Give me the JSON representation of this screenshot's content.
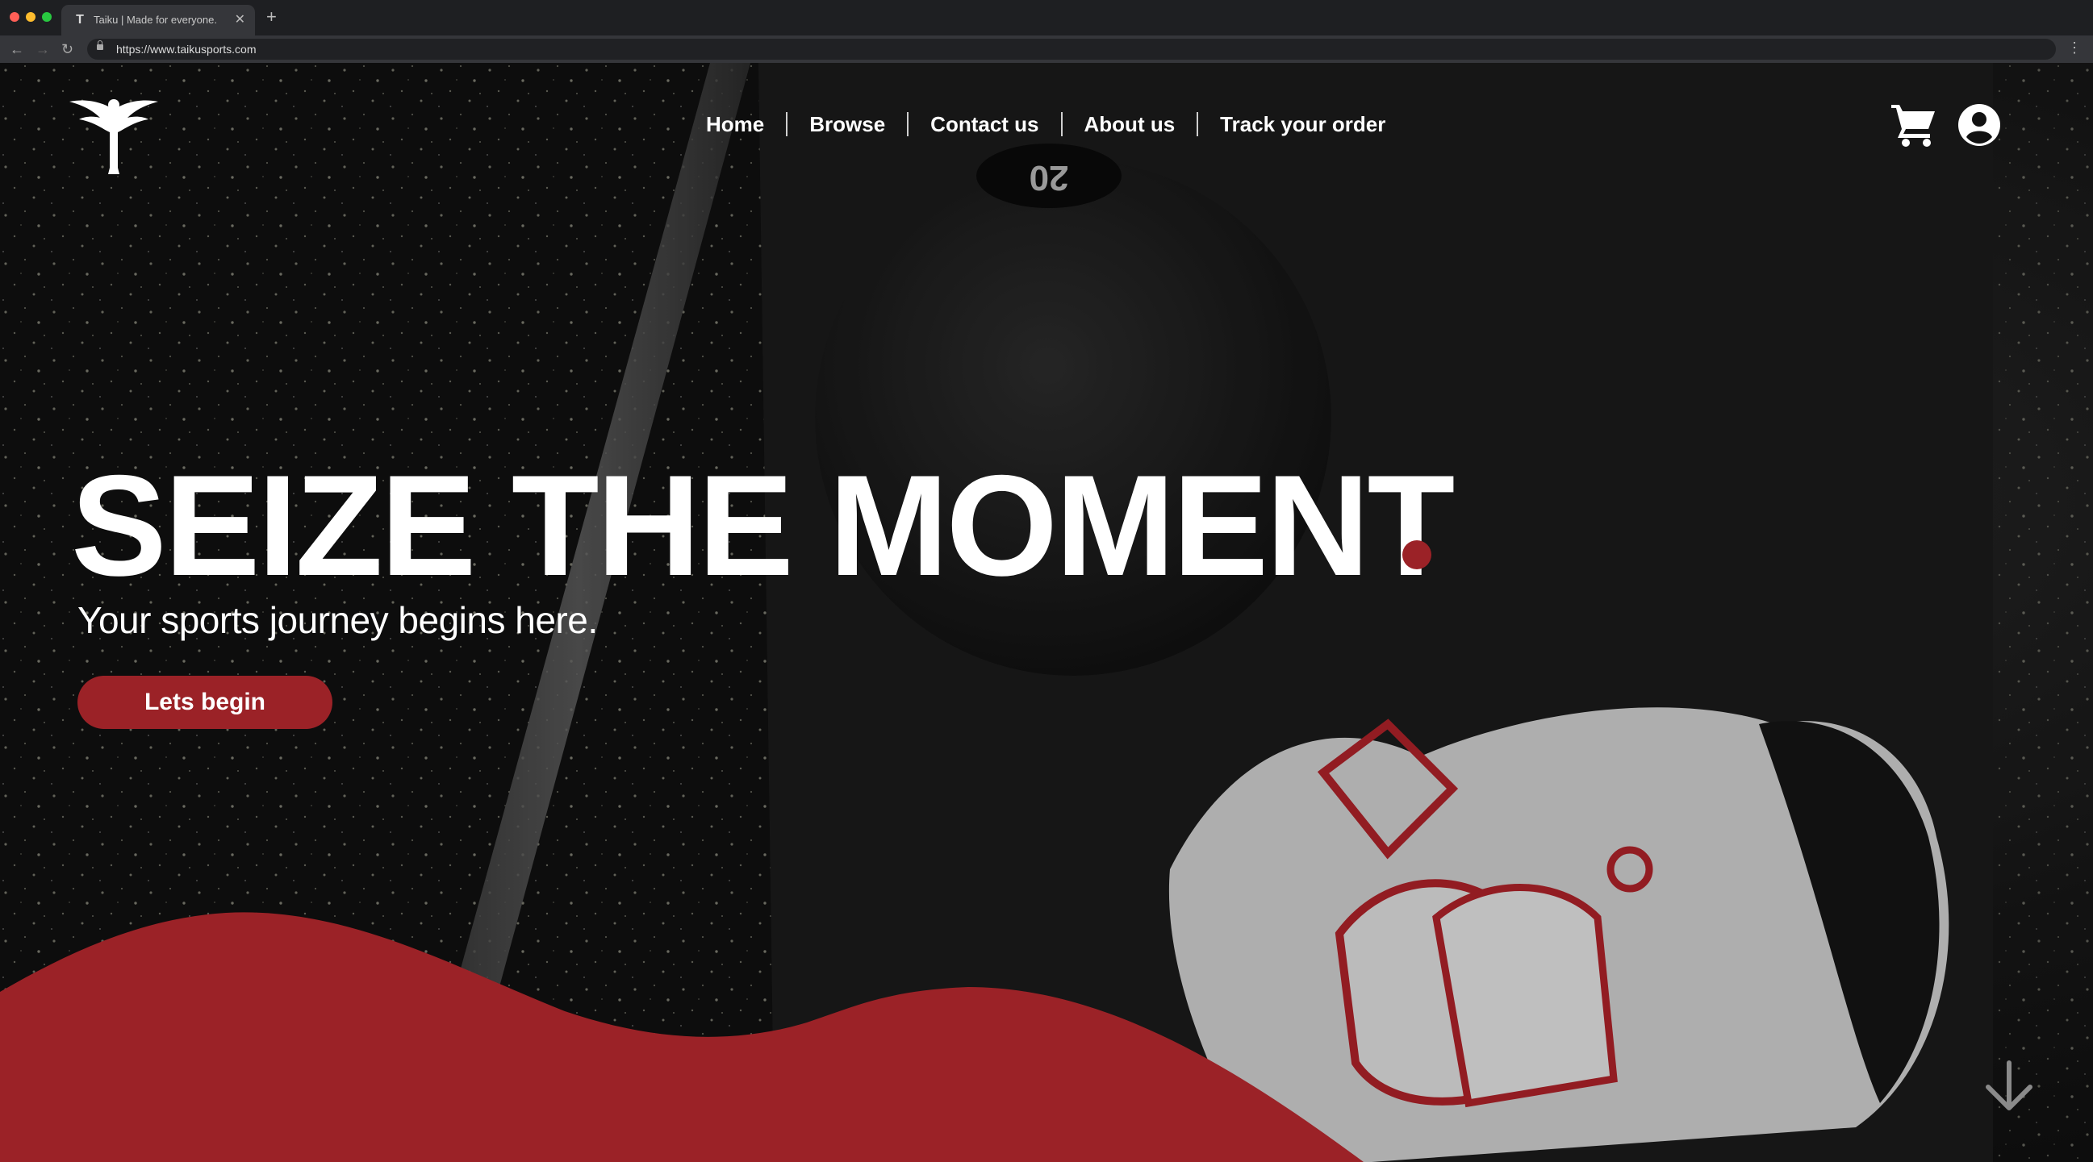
{
  "browser": {
    "tab_title": "Taiku | Made for everyone.",
    "tab_close": "✕",
    "new_tab": "+",
    "url": "https://www.taikusports.com"
  },
  "nav": {
    "items": [
      {
        "label": "Home"
      },
      {
        "label": "Browse"
      },
      {
        "label": "Contact us"
      },
      {
        "label": "About us"
      },
      {
        "label": "Track your order"
      }
    ]
  },
  "hero": {
    "title": "SEIZE THE MOMENT",
    "subtitle": "Your sports journey begins here.",
    "cta_label": "Lets begin",
    "accent_color": "#9b2227"
  },
  "background": {
    "ball_label": "20"
  },
  "icons": {
    "logo": "winged-figure-logo",
    "cart": "cart-icon",
    "account": "user-icon",
    "scroll": "arrow-down-icon"
  }
}
